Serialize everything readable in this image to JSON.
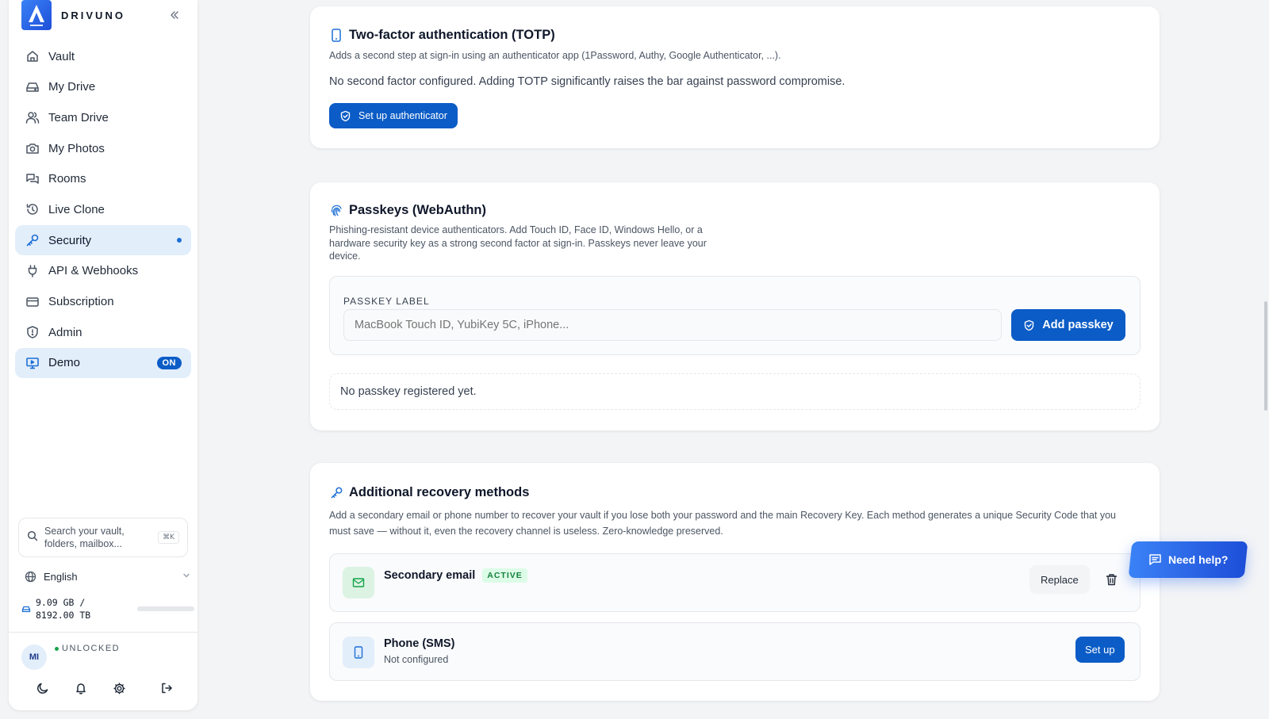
{
  "brand": {
    "name": "DRIVUNO"
  },
  "sidebar": {
    "items": [
      {
        "label": "Vault",
        "icon": "home-icon"
      },
      {
        "label": "My Drive",
        "icon": "drive-icon"
      },
      {
        "label": "Team Drive",
        "icon": "users-icon"
      },
      {
        "label": "My Photos",
        "icon": "camera-icon"
      },
      {
        "label": "Rooms",
        "icon": "chat-icon"
      },
      {
        "label": "Live Clone",
        "icon": "history-icon"
      },
      {
        "label": "Security",
        "icon": "key-icon",
        "active": true
      },
      {
        "label": "API & Webhooks",
        "icon": "plug-icon"
      },
      {
        "label": "Subscription",
        "icon": "card-icon"
      },
      {
        "label": "Admin",
        "icon": "shield-icon"
      },
      {
        "label": "Demo",
        "icon": "monitor-icon",
        "badge": "ON"
      }
    ],
    "search": {
      "placeholder": "Search your vault, folders, mailbox...",
      "shortcut": "⌘K"
    },
    "language": "English",
    "storage": {
      "line1": "9.09 GB /",
      "line2": "8192.00 TB",
      "used_fraction": 0.0
    },
    "user": {
      "initials": "MI",
      "status": "UNLOCKED"
    }
  },
  "totp": {
    "title": "Two-factor authentication (TOTP)",
    "subtitle": "Adds a second step at sign-in using an authenticator app (1Password, Authy, Google Authenticator, ...).",
    "status": "No second factor configured. Adding TOTP significantly raises the bar against password compromise.",
    "button": "Set up authenticator"
  },
  "passkeys": {
    "title": "Passkeys (WebAuthn)",
    "description": "Phishing-resistant device authenticators. Add Touch ID, Face ID, Windows Hello, or a hardware security key as a strong second factor at sign-in. Passkeys never leave your device.",
    "field_label": "PASSKEY LABEL",
    "placeholder": "MacBook Touch ID, YubiKey 5C, iPhone...",
    "add_button": "Add passkey",
    "empty": "No passkey registered yet."
  },
  "recovery": {
    "title": "Additional recovery methods",
    "description": "Add a secondary email or phone number to recover your vault if you lose both your password and the main Recovery Key. Each method generates a unique Security Code that you must save — without it, even the recovery channel is useless. Zero-knowledge preserved.",
    "email": {
      "label": "Secondary email",
      "tag": "ACTIVE",
      "replace": "Replace"
    },
    "phone": {
      "label": "Phone (SMS)",
      "status": "Not configured",
      "button": "Set up"
    }
  },
  "help": {
    "label": "Need help?"
  },
  "colors": {
    "accent": "#0b5cc6",
    "active_bg": "#e3eefb",
    "success": "#15803d"
  }
}
